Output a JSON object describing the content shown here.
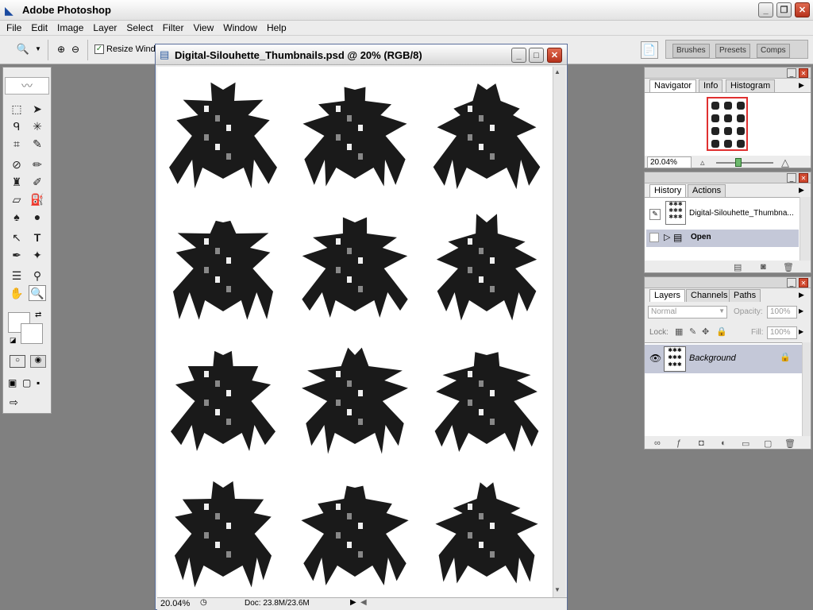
{
  "app": {
    "title": "Adobe Photoshop"
  },
  "menu": [
    "File",
    "Edit",
    "Image",
    "Layer",
    "Select",
    "Filter",
    "View",
    "Window",
    "Help"
  ],
  "options": {
    "resize_windows_label": "Resize Windo",
    "resize_windows_checked": true
  },
  "palette_well": {
    "tabs": [
      "Brushes",
      "Presets",
      "Comps"
    ]
  },
  "document": {
    "title": "Digital-Silouhette_Thumbnails.psd @ 20% (RGB/8)",
    "zoom": "20.04%",
    "doc_size": "Doc: 23.8M/23.6M",
    "thumbnail_rows": 4,
    "thumbnail_cols": 3
  },
  "navigator": {
    "tabs": [
      "Navigator",
      "Info",
      "Histogram"
    ],
    "zoom": "20.04%"
  },
  "history": {
    "tabs": [
      "History",
      "Actions"
    ],
    "snapshot_label": "Digital-Silouhette_Thumbna...",
    "steps": [
      "Open"
    ]
  },
  "layers": {
    "tabs": [
      "Layers",
      "Channels",
      "Paths"
    ],
    "blend_mode": "Normal",
    "opacity_label": "Opacity:",
    "opacity": "100%",
    "lock_label": "Lock:",
    "fill_label": "Fill:",
    "fill": "100%",
    "layer_name": "Background"
  },
  "colors": {
    "title_text": "#000000",
    "close_button": "#c83a22",
    "navigator_frame": "#e03030"
  }
}
